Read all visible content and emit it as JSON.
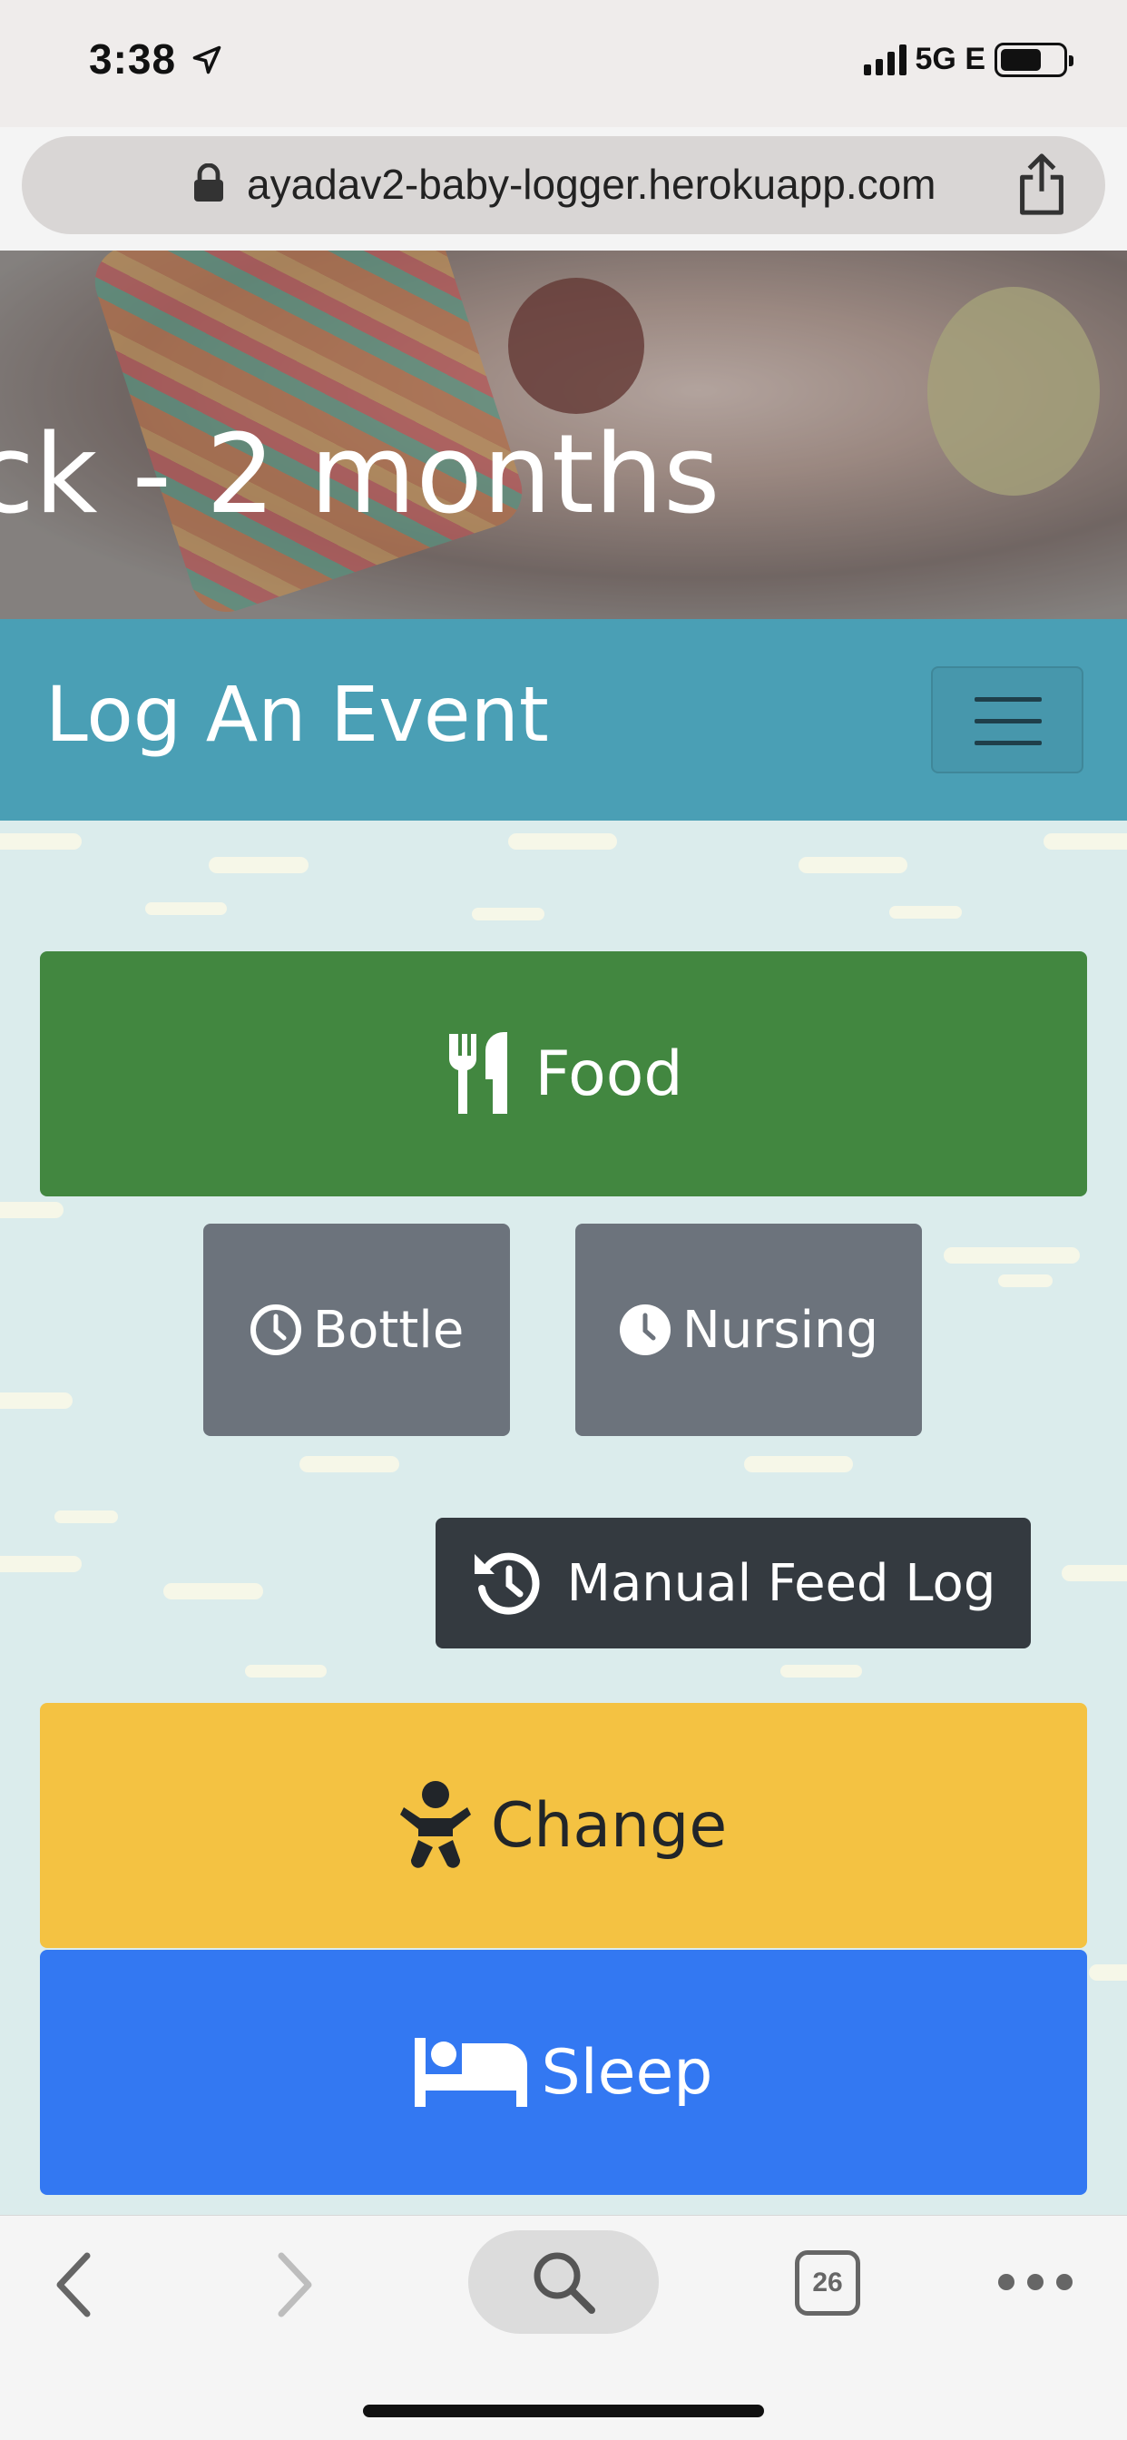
{
  "status_bar": {
    "time": "3:38",
    "network": "5G E",
    "icons": [
      "location-arrow-icon",
      "signal-icon",
      "battery-icon"
    ]
  },
  "browser": {
    "url": "ayadav2-baby-logger.herokuapp.com",
    "icons": [
      "lock-icon",
      "share-icon"
    ]
  },
  "hero": {
    "title": "ck - 2 months"
  },
  "navbar": {
    "brand": "Log An Event",
    "toggler_icon": "hamburger-menu-icon",
    "bg_color": "#4a9fb5"
  },
  "actions": {
    "food": {
      "label": "Food",
      "icon": "utensils-icon",
      "color": "#428740"
    },
    "bottle": {
      "label": "Bottle",
      "icon": "clock-outline-icon",
      "color": "#6c737c"
    },
    "nursing": {
      "label": "Nursing",
      "icon": "clock-solid-icon",
      "color": "#6c737c"
    },
    "manual_feed": {
      "label": "Manual Feed Log",
      "icon": "history-icon",
      "color": "#343a40"
    },
    "change": {
      "label": "Change",
      "icon": "baby-icon",
      "color": "#f4c242"
    },
    "sleep": {
      "label": "Sleep",
      "icon": "bed-icon",
      "color": "#3378f2"
    }
  },
  "toolbar": {
    "tab_count": "26",
    "icons": [
      "back-icon",
      "forward-icon",
      "search-icon",
      "tabs-icon",
      "more-icon"
    ]
  }
}
